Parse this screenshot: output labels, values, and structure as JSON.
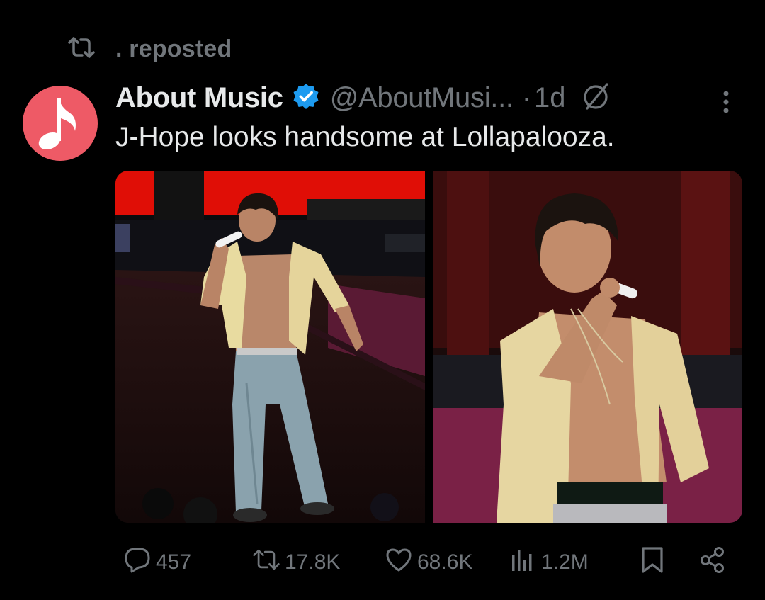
{
  "repost_banner": {
    "text": ". reposted",
    "icon": "repost-icon"
  },
  "post": {
    "author_name": "About Music",
    "verified_icon": "verified-badge-icon",
    "handle": "@AboutMusi...",
    "separator": "·",
    "time": "1d",
    "text": "J-Hope looks handsome at Lollapalooza.",
    "avatar_icon": "music-note-icon",
    "avatar_color": "#ee5a66"
  },
  "media": {
    "photos": [
      {
        "description_icon": "photo"
      },
      {
        "description_icon": "photo"
      }
    ]
  },
  "actions": {
    "replies": "457",
    "reposts": "17.8K",
    "likes": "68.6K",
    "views": "1.2M"
  },
  "colors": {
    "background": "#000000",
    "text_primary": "#e7e9ea",
    "text_secondary": "#71767b",
    "verified_blue": "#1d9bf0",
    "divider": "#2f3336"
  }
}
